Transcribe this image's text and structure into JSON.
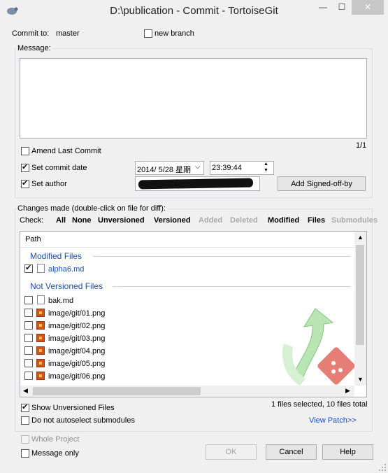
{
  "window": {
    "title": "D:\\publication - Commit - TortoiseGit",
    "min": "—",
    "max": "☐",
    "close": "✕"
  },
  "commit": {
    "label": "Commit to:",
    "branch": "master",
    "new_branch": "new branch"
  },
  "message": {
    "label": "Message:",
    "counter": "1/1",
    "text": ""
  },
  "options": {
    "amend": "Amend Last Commit",
    "set_date": "Set commit date",
    "date": "2014/  5/28 星期",
    "time": "23:39:44",
    "set_author": "Set author",
    "signed_off": "Add Signed-off-by"
  },
  "changes": {
    "label": "Changes made (double-click on file for diff):",
    "check_label": "Check:"
  },
  "check_links": [
    "All",
    "None",
    "Unversioned",
    "Versioned",
    "Added",
    "Deleted",
    "Modified",
    "Files",
    "Submodules"
  ],
  "list": {
    "header": "Path",
    "modified_header": "Modified Files",
    "modified_files": [
      "alpha6.md"
    ],
    "unversioned_header": "Not Versioned Files",
    "unversioned_files": [
      "bak.md",
      "image/git/01.png",
      "image/git/02.png",
      "image/git/03.png",
      "image/git/04.png",
      "image/git/05.png",
      "image/git/06.png"
    ]
  },
  "footer": {
    "show_unversioned": "Show Unversioned Files",
    "no_autoselect": "Do not autoselect submodules",
    "status": "1 files selected, 10 files total",
    "view_patch": "View Patch>>",
    "whole_project": "Whole Project",
    "message_only": "Message only",
    "ok": "OK",
    "cancel": "Cancel",
    "help": "Help"
  },
  "colors": {
    "accent": "#1e4e9e",
    "link": "#1a4fb4",
    "watermark_green": "#3aa83a",
    "git_red": "#d9463f"
  }
}
